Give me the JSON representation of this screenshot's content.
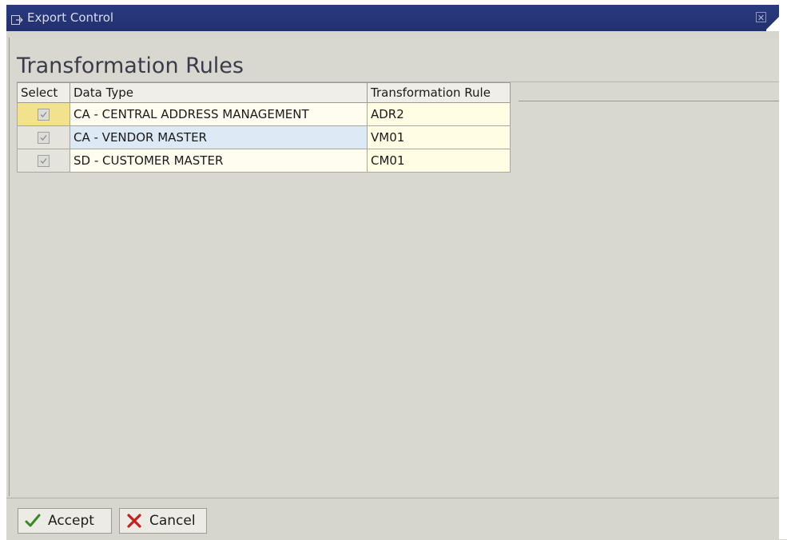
{
  "window": {
    "title": "Export Control",
    "icons": {
      "title": "export-icon",
      "close": "close-icon"
    }
  },
  "page": {
    "heading": "Transformation Rules"
  },
  "table": {
    "columns": [
      "Select",
      "Data Type",
      "Transformation Rule"
    ],
    "rows": [
      {
        "selected": true,
        "data_type": "CA - CENTRAL ADDRESS MANAGEMENT",
        "rule": "ADR2"
      },
      {
        "selected": true,
        "data_type": "CA - VENDOR MASTER",
        "rule": "VM01"
      },
      {
        "selected": true,
        "data_type": "SD - CUSTOMER MASTER",
        "rule": "CM01"
      }
    ]
  },
  "buttons": {
    "accept": "Accept",
    "cancel": "Cancel",
    "accept_icon": "checkmark-icon",
    "cancel_icon": "cross-icon"
  },
  "colors": {
    "titlebar": "#22306d",
    "accept_check": "#3a8a1f",
    "cancel_cross": "#c8201c"
  }
}
